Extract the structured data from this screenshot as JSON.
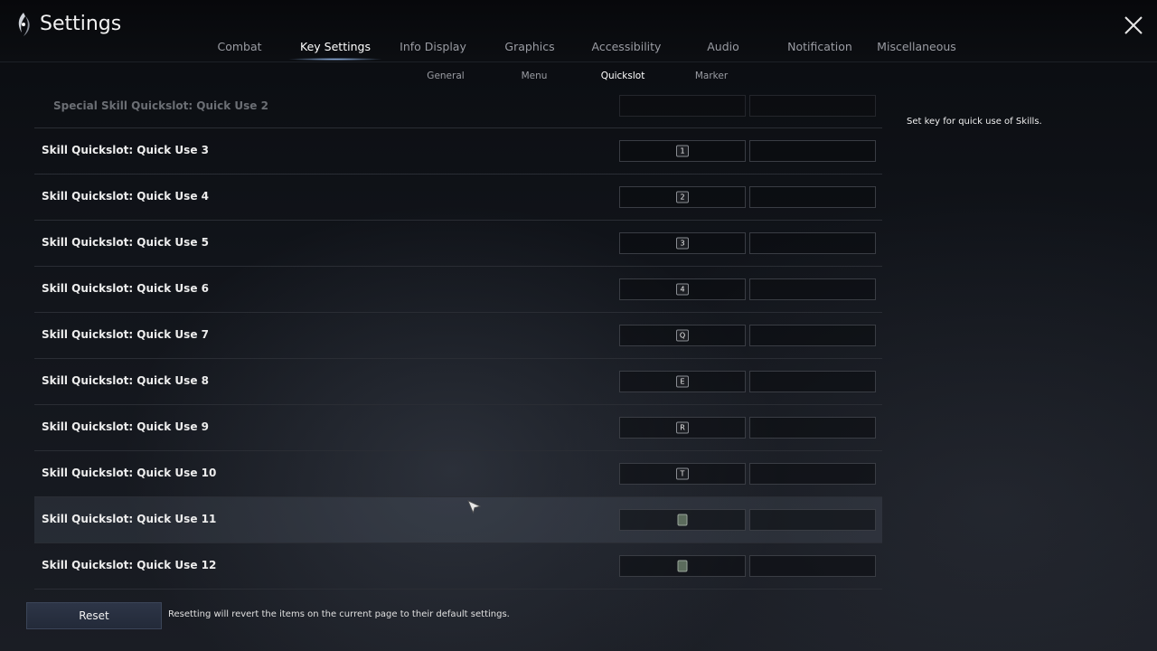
{
  "window": {
    "title": "Settings"
  },
  "tabs": [
    {
      "label": "Combat",
      "active": false
    },
    {
      "label": "Key Settings",
      "active": true
    },
    {
      "label": "Info Display",
      "active": false
    },
    {
      "label": "Graphics",
      "active": false
    },
    {
      "label": "Accessibility",
      "active": false
    },
    {
      "label": "Audio",
      "active": false
    },
    {
      "label": "Notification",
      "active": false
    },
    {
      "label": "Miscellaneous",
      "active": false
    }
  ],
  "subtabs": [
    {
      "label": "General",
      "active": false
    },
    {
      "label": "Menu",
      "active": false
    },
    {
      "label": "Quickslot",
      "active": true
    },
    {
      "label": "Marker",
      "active": false
    }
  ],
  "rows": [
    {
      "label": "Special Skill Quickslot: Quick Use 2",
      "primary": "",
      "secondary": "",
      "faded": true
    },
    {
      "label": "Skill Quickslot: Quick Use 3",
      "primary": "1",
      "secondary": ""
    },
    {
      "label": "Skill Quickslot: Quick Use 4",
      "primary": "2",
      "secondary": ""
    },
    {
      "label": "Skill Quickslot: Quick Use 5",
      "primary": "3",
      "secondary": ""
    },
    {
      "label": "Skill Quickslot: Quick Use 6",
      "primary": "4",
      "secondary": ""
    },
    {
      "label": "Skill Quickslot: Quick Use 7",
      "primary": "Q",
      "secondary": ""
    },
    {
      "label": "Skill Quickslot: Quick Use 8",
      "primary": "E",
      "secondary": ""
    },
    {
      "label": "Skill Quickslot: Quick Use 9",
      "primary": "R",
      "secondary": ""
    },
    {
      "label": "Skill Quickslot: Quick Use 10",
      "primary": "T",
      "secondary": ""
    },
    {
      "label": "Skill Quickslot: Quick Use 11",
      "primary": "",
      "primary_icon": "mouse-button-icon",
      "secondary": "",
      "highlight": true
    },
    {
      "label": "Skill Quickslot: Quick Use 12",
      "primary": "",
      "primary_icon": "mouse-button-icon",
      "secondary": ""
    }
  ],
  "description": "Set key for quick use of Skills.",
  "footer": {
    "reset_label": "Reset",
    "reset_note": "Resetting will revert the items on the current page to their default settings."
  },
  "icons": {
    "logo": "game-logo-icon",
    "close": "close-icon",
    "cursor": "mouse-cursor-icon"
  },
  "colors": {
    "active_tab": "#ffffff",
    "inactive_tab": "#9a9ca3",
    "reset_button": "#2d3547"
  }
}
